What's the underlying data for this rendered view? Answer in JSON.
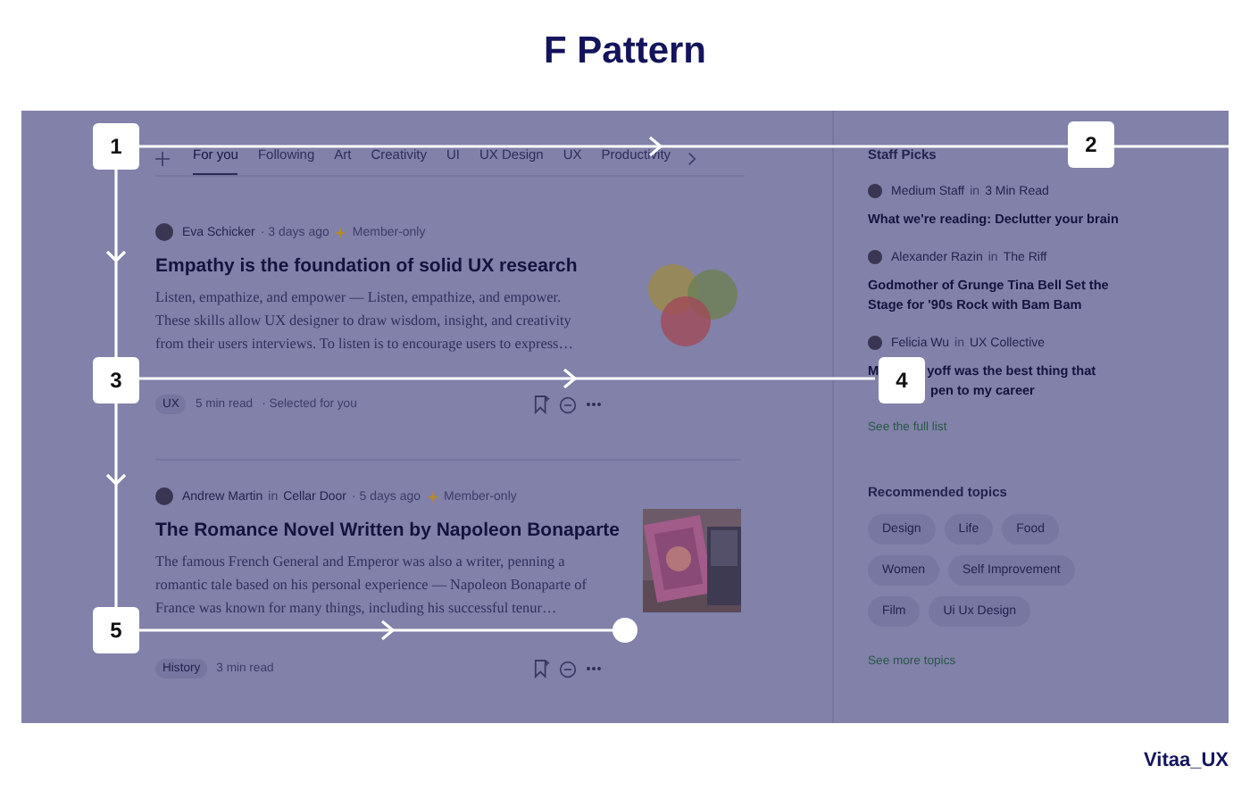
{
  "title": "F Pattern",
  "feed": {
    "tabs": [
      {
        "label": "For you",
        "selected": true
      },
      {
        "label": "Following",
        "selected": false
      },
      {
        "label": "Art",
        "selected": false
      },
      {
        "label": "Creativity",
        "selected": false
      },
      {
        "label": "UI",
        "selected": false
      },
      {
        "label": "UX Design",
        "selected": false
      },
      {
        "label": "UX",
        "selected": false
      },
      {
        "label": "Productivity",
        "selected": false
      }
    ],
    "articles": [
      {
        "author": "Eva Schicker",
        "time": "· 3 days ago",
        "member": "Member-only",
        "title": "Empathy is the foundation of solid UX research",
        "excerpt": "Listen, empathize, and empower — Listen, empathize, and empower. These skills allow UX designer to draw wisdom, insight, and creativity from their users interviews. To listen is to encourage users to express…",
        "tag": "UX",
        "read_time": "5 min read",
        "note": "· Selected for you",
        "image": {
          "kind": "venn"
        }
      },
      {
        "author": "Andrew Martin",
        "in": "in",
        "publication": "Cellar Door",
        "time": "· 5 days ago",
        "member": "Member-only",
        "title": "The Romance Novel Written by Napoleon Bonaparte",
        "excerpt": "The famous French General and Emperor was also a writer, penning a romantic tale based on his personal experience — Napoleon Bonaparte of France was known for many things, including his successful tenur…",
        "tag": "History",
        "read_time": "3 min read"
      }
    ]
  },
  "sidebar": {
    "staff_picks": {
      "heading": "Staff Picks",
      "items": [
        {
          "author": "Medium Staff",
          "in": "in",
          "publication": "3 Min Read",
          "title_parts": [
            "What we're reading: Declutter your brain"
          ]
        },
        {
          "author": "Alexander Razin",
          "in": "in",
          "publication": "The Riff",
          "title_parts": [
            "Godmother of Grunge Tina Bell Set the Stage for '90s Rock with Bam Bam"
          ]
        },
        {
          "author": "Felicia Wu",
          "in": "in",
          "publication": "UX Collective",
          "title_parts": [
            "M",
            "yoff was the best thing that",
            "pen to my career"
          ]
        }
      ],
      "link": "See the full list"
    },
    "topics": {
      "heading": "Recommended topics",
      "chips": [
        "Design",
        "Life",
        "Food",
        "Women",
        "Self Improvement",
        "Film",
        "Ui Ux Design"
      ],
      "link": "See more topics"
    }
  },
  "steps": [
    "1",
    "2",
    "3",
    "4",
    "5"
  ],
  "credit": "Vitaa_UX"
}
